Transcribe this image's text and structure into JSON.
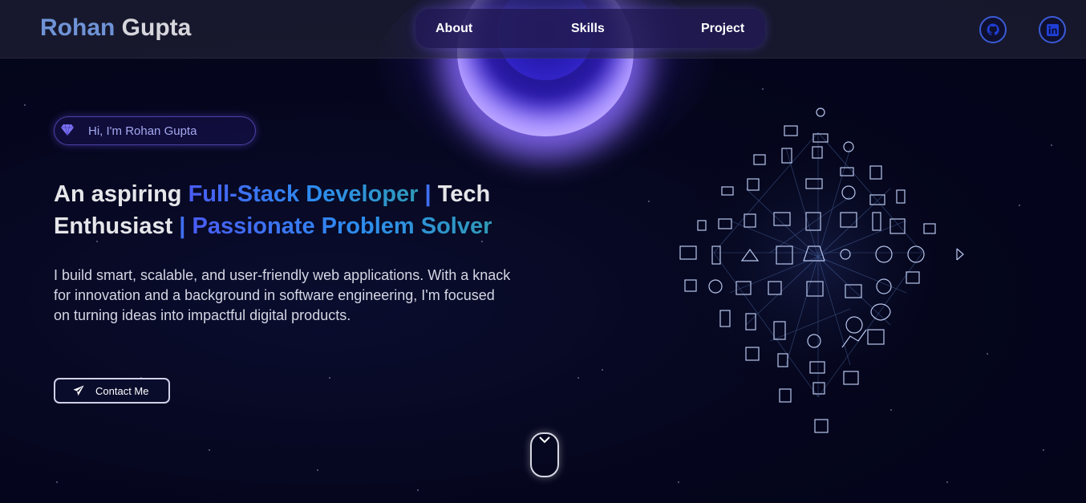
{
  "header": {
    "brand_first": "Rohan",
    "brand_last": "Gupta",
    "nav": [
      {
        "label": "About"
      },
      {
        "label": "Skills"
      },
      {
        "label": "Project"
      }
    ],
    "social": [
      {
        "icon": "github-icon"
      },
      {
        "icon": "linkedin-icon"
      }
    ]
  },
  "hero": {
    "greeting": "Hi, I'm Rohan Gupta",
    "headline": {
      "part1": "An aspiring ",
      "part2": "Full-Stack Developer",
      "sep1": " | ",
      "part3": "Tech Enthusiast",
      "sep2": " | ",
      "part4": "Passionate Problem Solver"
    },
    "description": "I build smart, scalable, and user-friendly web applications. With a knack for innovation and a background in software engineering, I'm focused on turning ideas into impactful digital products.",
    "contact_label": "Contact Me"
  },
  "colors": {
    "background": "#03041a",
    "accent": "#4a5cf5",
    "brand_first": "#6f93d6",
    "glow": "#6a50ff"
  }
}
